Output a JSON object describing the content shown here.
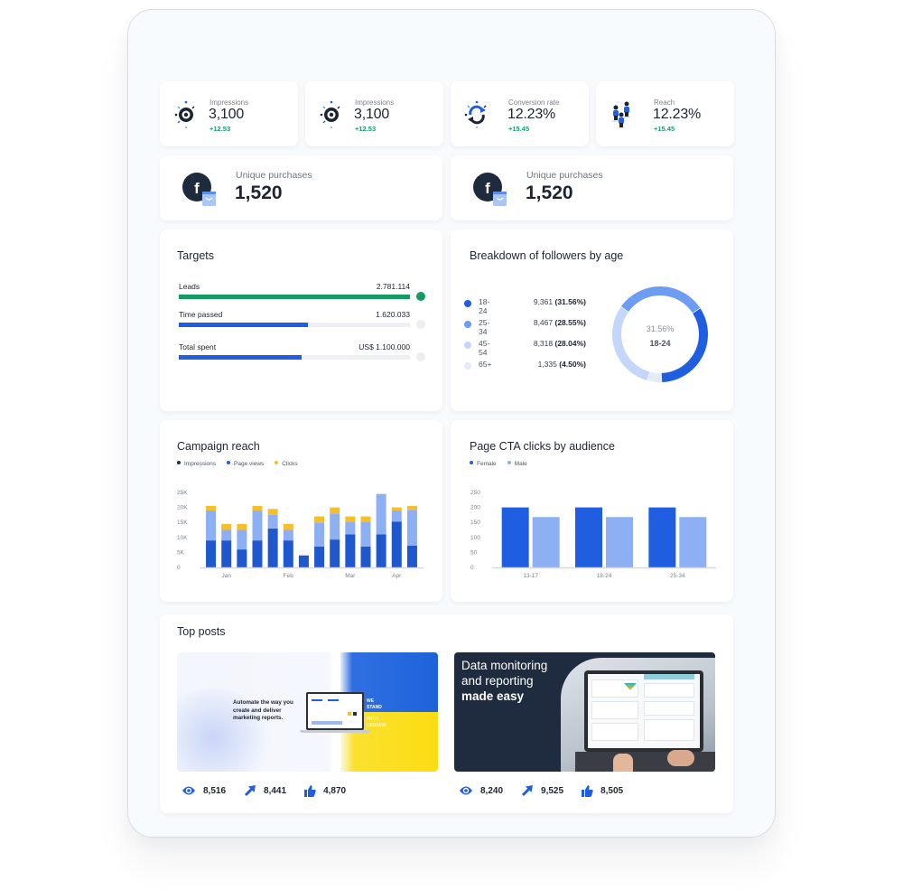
{
  "kpis": [
    {
      "label": "Impressions",
      "value": "3,100",
      "change": "+12.53",
      "icon": "eye-icon"
    },
    {
      "label": "Impressions",
      "value": "3,100",
      "change": "+12.53",
      "icon": "eye-icon"
    },
    {
      "label": "Conversion rate",
      "value": "12.23%",
      "change": "+15.45",
      "icon": "refresh-cycle-icon"
    },
    {
      "label": "Reach",
      "value": "12.23%",
      "change": "+15.45",
      "icon": "people-icon"
    }
  ],
  "unique_purchases": [
    {
      "label": "Unique purchases",
      "value": "1,520",
      "icon": "facebook-shopping-bag-icon"
    },
    {
      "label": "Unique purchases",
      "value": "1,520",
      "icon": "facebook-shopping-bag-icon"
    }
  ],
  "targets": {
    "title": "Targets",
    "rows": [
      {
        "label": "Leads",
        "value": "2.781.114",
        "progress": 1.0,
        "color": "#159a64",
        "complete": true
      },
      {
        "label": "Time passed",
        "value": "1.620.033",
        "progress": 0.56,
        "color": "#1f5ee0",
        "complete": false
      },
      {
        "label": "Total spent",
        "value": "US$ 1.100.000",
        "progress": 0.53,
        "color": "#1f5ee0",
        "complete": false
      }
    ]
  },
  "followers": {
    "title": "Breakdown of followers by age",
    "center_percent": "31.56%",
    "center_label": "18-24",
    "rows": [
      {
        "age": "18-24",
        "count": "9,361",
        "pct": "(31.56%)",
        "value": 31.56,
        "color": "#1f5ee0"
      },
      {
        "age": "25-34",
        "count": "8,467",
        "pct": "(28.55%)",
        "value": 28.55,
        "color": "#6d9cf3"
      },
      {
        "age": "45-54",
        "count": "8,318",
        "pct": "(28.04%)",
        "value": 28.04,
        "color": "#c4d7fa"
      },
      {
        "age": "65+",
        "count": "1,335",
        "pct": "(4.50%)",
        "value": 4.5,
        "color": "#e3ebfc"
      }
    ]
  },
  "chart_data": [
    {
      "type": "bar",
      "stacked": true,
      "title": "Campaign reach",
      "legend": [
        "Impressions",
        "Page views",
        "Clicks"
      ],
      "legend_placement": "top-left",
      "legend_colors": [
        "#1b2f57",
        "#1f5ee0",
        "#f6be27"
      ],
      "x_tick_labels": [
        "Jan",
        "Feb",
        "Mar",
        "Apr"
      ],
      "x_tick_positions": [
        1.5,
        5.5,
        9.5,
        12.5
      ],
      "yticks": [
        "0",
        "5K",
        "10K",
        "15K",
        "20K",
        "25K"
      ],
      "ylim": [
        0,
        25000
      ],
      "series": [
        {
          "name": "Impressions",
          "color": "#1f57cf",
          "values": [
            9000,
            9000,
            6000,
            9000,
            13000,
            9000,
            4000,
            7000,
            9300,
            11000,
            7000,
            11000,
            15300,
            7300
          ]
        },
        {
          "name": "Page views",
          "color": "#8db0f5",
          "values": [
            10000,
            3500,
            6500,
            10000,
            4500,
            3500,
            0,
            8000,
            8700,
            4300,
            8300,
            13500,
            3700,
            11900
          ]
        },
        {
          "name": "Clicks",
          "color": "#f6be27",
          "values": [
            1500,
            2000,
            2000,
            1500,
            2000,
            2000,
            0,
            2000,
            2000,
            1700,
            1700,
            0,
            1000,
            1300
          ]
        }
      ]
    },
    {
      "type": "bar",
      "title": "Page CTA clicks by audience",
      "legend": [
        "Female",
        "Male"
      ],
      "legend_placement": "top-left",
      "categories": [
        "13-17",
        "18-24",
        "25-34"
      ],
      "yticks": [
        "0",
        "50",
        "100",
        "150",
        "200",
        "250"
      ],
      "ylim": [
        0,
        250
      ],
      "series": [
        {
          "name": "Female",
          "color": "#1f5ee0",
          "values": [
            200,
            200,
            200
          ]
        },
        {
          "name": "Male",
          "color": "#8db0f5",
          "values": [
            168,
            168,
            168
          ]
        }
      ]
    }
  ],
  "top_posts": {
    "title": "Top posts",
    "posts": [
      {
        "image_text": "Automate the way you create and deliver marketing  reports.",
        "banner_line1": "WE",
        "banner_line2": "STAND",
        "banner_line3": "WITH",
        "banner_line4": "UKRAINE",
        "views": "8,516",
        "shares": "8,441",
        "likes": "4,870"
      },
      {
        "image_line1": "Data monitoring",
        "image_line2": "and reporting",
        "image_line3": "made easy",
        "views": "8,240",
        "shares": "9,525",
        "likes": "8,505"
      }
    ]
  }
}
